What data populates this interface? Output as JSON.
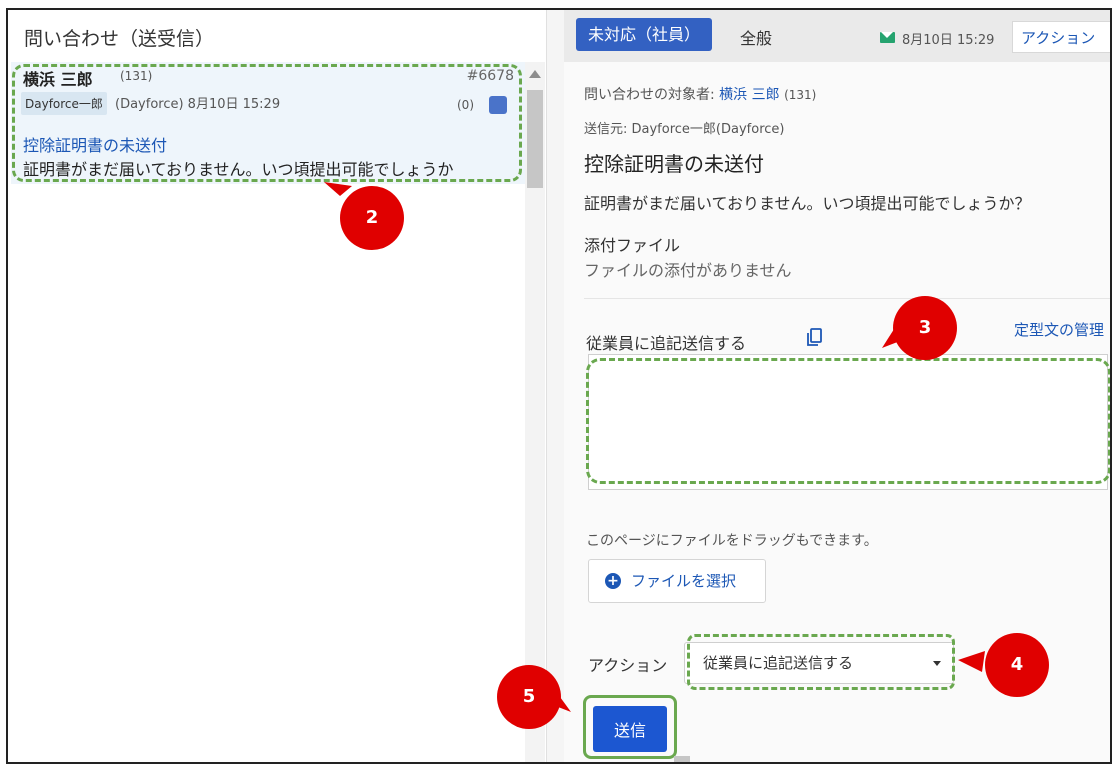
{
  "inbox": {
    "title": "問い合わせ（送受信）",
    "message": {
      "sender_name": "横浜 三郎",
      "sender_count": "(131)",
      "ticket_id": "#6678",
      "sender_tag": "Dayforce一郎",
      "meta": "(Dayforce) 8月10日 15:29",
      "reply_count": "(0)",
      "subject": "控除証明書の未送付",
      "preview": "証明書がまだ届いておりません。いつ頃提出可能でしょうか"
    }
  },
  "detail": {
    "status": "未対応（社員）",
    "category": "全般",
    "date": "8月10日 15:29",
    "action_button": "アクション",
    "target_label": "問い合わせの対象者:",
    "target_name": "横浜 三郎",
    "target_count": "(131)",
    "from": "送信元: Dayforce一郎(Dayforce)",
    "subject": "控除証明書の未送付",
    "body": "証明書がまだ届いておりません。いつ頃提出可能でしょうか？",
    "attachments_label": "添付ファイル",
    "attachments_none": "ファイルの添付がありません"
  },
  "reply": {
    "label": "従業員に追記送信する",
    "template_link": "定型文の管理",
    "drag_hint": "このページにファイルをドラッグもできます。",
    "file_button": "ファイルを選択",
    "action_label": "アクション",
    "action_selected": "従業員に追記送信する",
    "send_button": "送信"
  },
  "callouts": [
    "2",
    "3",
    "4",
    "5"
  ],
  "colors": {
    "primary": "#1c57d1",
    "status": "#3361c2",
    "highlight": "#6aa84f",
    "callout": "#e00000",
    "mail_icon": "#25a36f"
  }
}
